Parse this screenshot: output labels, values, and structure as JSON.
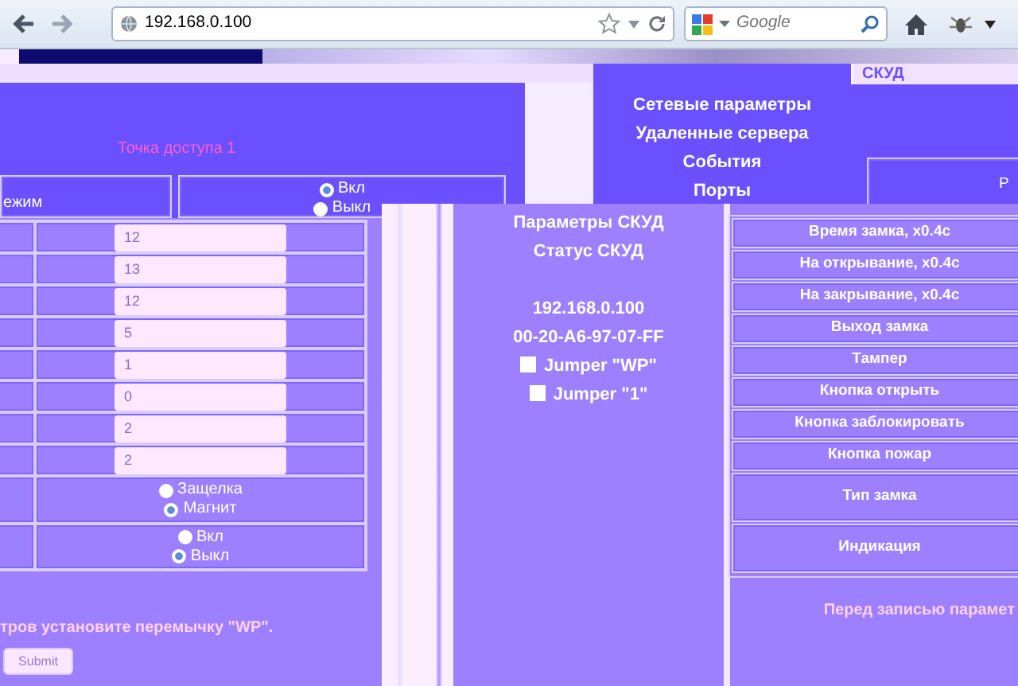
{
  "browser": {
    "url": "192.168.0.100",
    "search_placeholder": "Google"
  },
  "access_point": {
    "title": "Точка доступа 1",
    "mode_label": "ежим",
    "mode_options": [
      {
        "label": "Вкл",
        "selected": true
      },
      {
        "label": "Выкл",
        "selected": false
      }
    ]
  },
  "form": {
    "inputs": [
      "12",
      "13",
      "12",
      "5",
      "1",
      "0",
      "2",
      "2"
    ],
    "lock_type": [
      {
        "label": "Защелка",
        "selected": false
      },
      {
        "label": "Магнит",
        "selected": true
      }
    ],
    "indication": [
      {
        "label": "Вкл",
        "selected": false
      },
      {
        "label": "Выкл",
        "selected": true
      }
    ],
    "notice": "тров установите перемычку \"WP\".",
    "submit": "Submit"
  },
  "menu": [
    "Сетевые параметры",
    "Удаленные сервера",
    "События",
    "Порты"
  ],
  "status": {
    "lines": [
      "Параметры СКУД",
      "Статус СКУД"
    ],
    "ip": "192.168.0.100",
    "mac": "00-20-A6-97-07-FF",
    "jumpers": [
      {
        "label": "Jumper \"WP\"",
        "checked": false
      },
      {
        "label": "Jumper \"1\"",
        "checked": false
      }
    ]
  },
  "right": {
    "header": "СКУД",
    "cut_label": "Р",
    "labels": [
      "Время замка, x0.4с",
      "На открывание, x0.4с",
      "На закрывание, x0.4с",
      "Выход замка",
      "Тампер",
      "Кнопка открыть",
      "Кнопка заблокировать",
      "Кнопка пожар",
      "Тип замка",
      "Индикация"
    ],
    "notice": "Перед записью парамет"
  }
}
